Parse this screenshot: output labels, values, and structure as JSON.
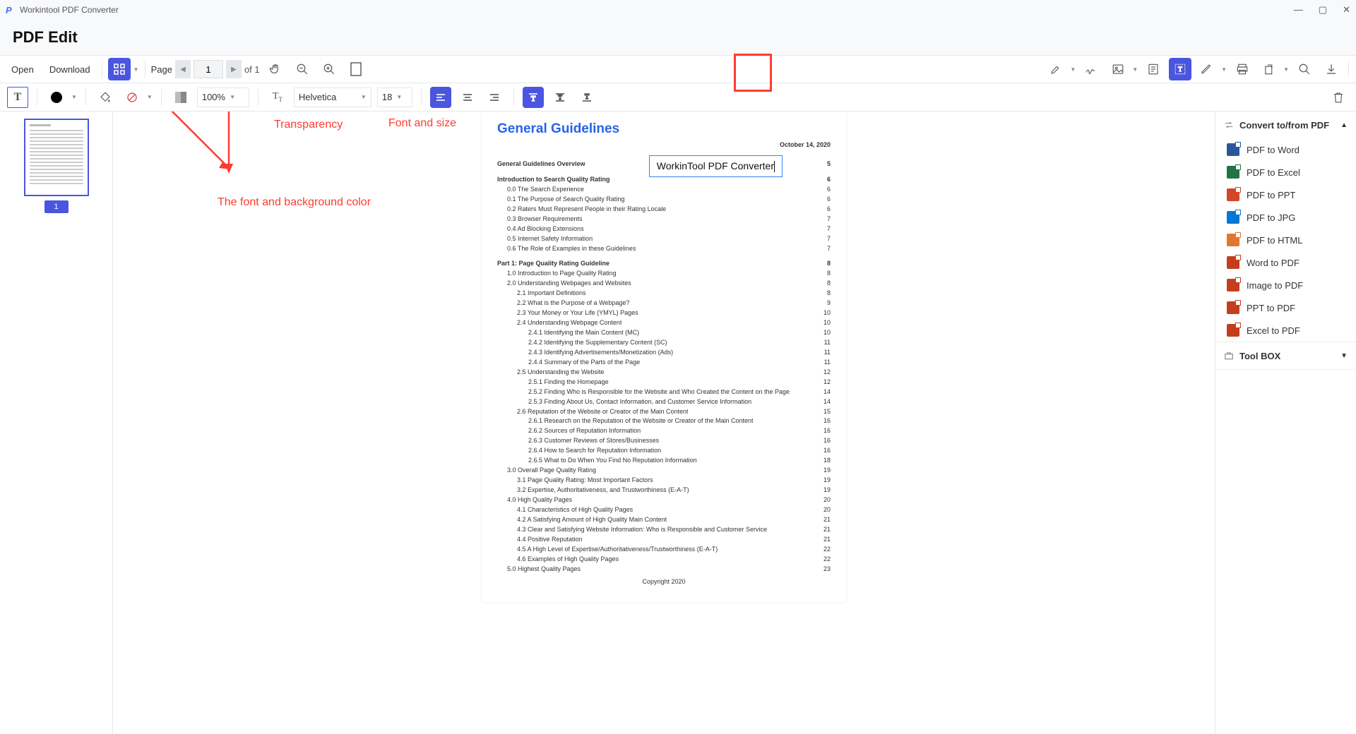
{
  "titlebar": {
    "app_name": "Workintool PDF Converter"
  },
  "header": {
    "title": "PDF Edit"
  },
  "maintoolbar": {
    "open": "Open",
    "download": "Download",
    "page_label": "Page",
    "page_value": "1",
    "page_total": "of 1"
  },
  "proptoolbar": {
    "opacity": "100%",
    "font": "Helvetica",
    "size": "18"
  },
  "annotations": {
    "transparency": "Transparency",
    "fontsize": "Font and size",
    "fontbg": "The font and background color"
  },
  "thumb": {
    "num": "1"
  },
  "rightpanel": {
    "convert_header": "Convert to/from PDF",
    "items": [
      {
        "label": "PDF to Word",
        "color": "#2b579a"
      },
      {
        "label": "PDF to Excel",
        "color": "#217346"
      },
      {
        "label": "PDF to PPT",
        "color": "#d24726"
      },
      {
        "label": "PDF to JPG",
        "color": "#0078d4"
      },
      {
        "label": "PDF to HTML",
        "color": "#e3762c"
      },
      {
        "label": "Word to PDF",
        "color": "#c43e1c"
      },
      {
        "label": "Image to PDF",
        "color": "#c43e1c"
      },
      {
        "label": "PPT to PDF",
        "color": "#c43e1c"
      },
      {
        "label": "Excel to PDF",
        "color": "#c43e1c"
      }
    ],
    "toolbox": "Tool BOX"
  },
  "doc": {
    "title": "General Guidelines",
    "date": "October 14, 2020",
    "textbox": "WorkinTool PDF Converter",
    "copyright": "Copyright 2020",
    "toc": [
      {
        "t": "General Guidelines Overview",
        "p": "5",
        "cls": "bold"
      },
      {
        "t": "Introduction to Search Quality Rating",
        "p": "6",
        "cls": "bold"
      },
      {
        "t": "0.0 The Search Experience",
        "p": "6",
        "cls": "ind1"
      },
      {
        "t": "0.1 The Purpose of Search Quality Rating",
        "p": "6",
        "cls": "ind1"
      },
      {
        "t": "0.2 Raters Must Represent People in their Rating Locale",
        "p": "6",
        "cls": "ind1"
      },
      {
        "t": "0.3 Browser Requirements",
        "p": "7",
        "cls": "ind1"
      },
      {
        "t": "0.4 Ad Blocking Extensions",
        "p": "7",
        "cls": "ind1"
      },
      {
        "t": "0.5 Internet Safety Information",
        "p": "7",
        "cls": "ind1"
      },
      {
        "t": "0.6 The Role of Examples in these Guidelines",
        "p": "7",
        "cls": "ind1"
      },
      {
        "t": "Part 1: Page Quality Rating Guideline",
        "p": "8",
        "cls": "bold"
      },
      {
        "t": "1.0 Introduction to Page Quality Rating",
        "p": "8",
        "cls": "ind1"
      },
      {
        "t": "2.0 Understanding Webpages and Websites",
        "p": "8",
        "cls": "ind1"
      },
      {
        "t": "2.1 Important Definitions",
        "p": "8",
        "cls": "ind2"
      },
      {
        "t": "2.2 What is the Purpose of a Webpage?",
        "p": "9",
        "cls": "ind2"
      },
      {
        "t": "2.3 Your Money or Your Life (YMYL) Pages",
        "p": "10",
        "cls": "ind2"
      },
      {
        "t": "2.4 Understanding Webpage Content",
        "p": "10",
        "cls": "ind2"
      },
      {
        "t": "2.4.1 Identifying the Main Content (MC)",
        "p": "10",
        "cls": "ind3"
      },
      {
        "t": "2.4.2 Identifying the Supplementary Content (SC)",
        "p": "11",
        "cls": "ind3"
      },
      {
        "t": "2.4.3 Identifying Advertisements/Monetization (Ads)",
        "p": "11",
        "cls": "ind3"
      },
      {
        "t": "2.4.4 Summary of the Parts of the Page",
        "p": "11",
        "cls": "ind3"
      },
      {
        "t": "2.5 Understanding the Website",
        "p": "12",
        "cls": "ind2"
      },
      {
        "t": "2.5.1 Finding the Homepage",
        "p": "12",
        "cls": "ind3"
      },
      {
        "t": "2.5.2 Finding Who is Responsible for the Website and Who Created the Content on the Page",
        "p": "14",
        "cls": "ind3"
      },
      {
        "t": "2.5.3 Finding About Us, Contact Information, and Customer Service Information",
        "p": "14",
        "cls": "ind3"
      },
      {
        "t": "2.6 Reputation of the Website or Creator of the Main Content",
        "p": "15",
        "cls": "ind2"
      },
      {
        "t": "2.6.1 Research on the Reputation of the Website or Creator of the Main Content",
        "p": "16",
        "cls": "ind3"
      },
      {
        "t": "2.6.2 Sources of Reputation Information",
        "p": "16",
        "cls": "ind3"
      },
      {
        "t": "2.6.3 Customer Reviews of Stores/Businesses",
        "p": "16",
        "cls": "ind3"
      },
      {
        "t": "2.6.4 How to Search for Reputation Information",
        "p": "16",
        "cls": "ind3"
      },
      {
        "t": "2.6.5 What to Do When You Find No Reputation Information",
        "p": "18",
        "cls": "ind3"
      },
      {
        "t": "3.0 Overall Page Quality Rating",
        "p": "19",
        "cls": "ind1"
      },
      {
        "t": "3.1 Page Quality Rating: Most Important Factors",
        "p": "19",
        "cls": "ind2"
      },
      {
        "t": "3.2 Expertise, Authoritativeness, and Trustworthiness (E-A-T)",
        "p": "19",
        "cls": "ind2"
      },
      {
        "t": "4.0 High Quality Pages",
        "p": "20",
        "cls": "ind1"
      },
      {
        "t": "4.1 Characteristics of High Quality Pages",
        "p": "20",
        "cls": "ind2"
      },
      {
        "t": "4.2 A Satisfying Amount of High Quality Main Content",
        "p": "21",
        "cls": "ind2"
      },
      {
        "t": "4.3 Clear and Satisfying Website Information: Who is Responsible and Customer Service",
        "p": "21",
        "cls": "ind2"
      },
      {
        "t": "4.4 Positive Reputation",
        "p": "21",
        "cls": "ind2"
      },
      {
        "t": "4.5 A High Level of Expertise/Authoritativeness/Trustworthiness (E-A-T)",
        "p": "22",
        "cls": "ind2"
      },
      {
        "t": "4.6 Examples of High Quality Pages",
        "p": "22",
        "cls": "ind2"
      },
      {
        "t": "5.0 Highest Quality Pages",
        "p": "23",
        "cls": "ind1"
      }
    ]
  }
}
